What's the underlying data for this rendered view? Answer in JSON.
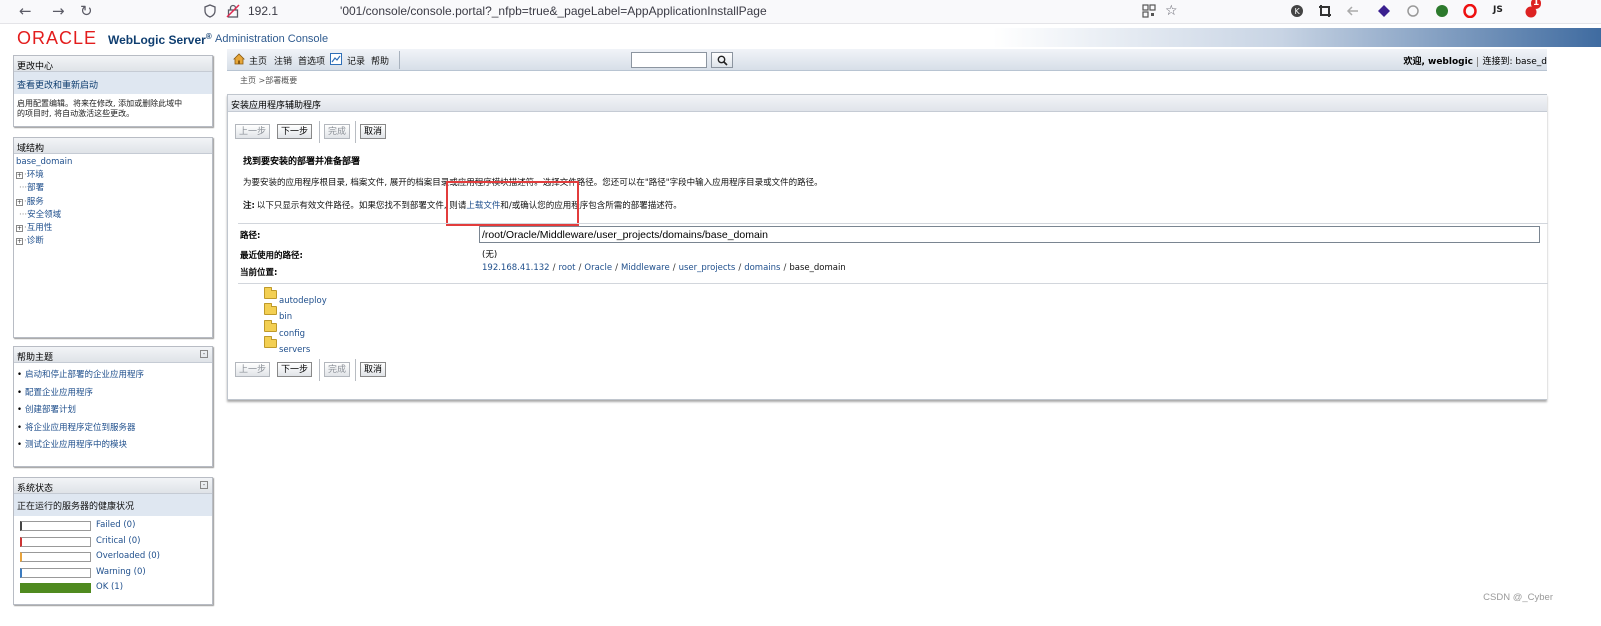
{
  "browser": {
    "url_prefix": "192.1",
    "url_suffix": "'001/console/console.portal?_nfpb=true&_pageLabel=AppApplicationInstallPage",
    "notification_count": "1",
    "extension_js_label": "JS"
  },
  "header": {
    "logo": "ORACLE",
    "product": "WebLogic Server",
    "registered": "®",
    "console": "Administration Console"
  },
  "change_center": {
    "title": "更改中心",
    "link": "查看更改和重新启动",
    "description_line1": "启用配置编辑。将来在修改, 添加或删除此域中",
    "description_line2": "的项目时, 将自动激活这些更改。"
  },
  "domain_structure": {
    "title": "域结构",
    "root": "base_domain",
    "items": [
      {
        "label": "环境",
        "expandable": true
      },
      {
        "label": "部署",
        "expandable": false
      },
      {
        "label": "服务",
        "expandable": true
      },
      {
        "label": "安全领域",
        "expandable": false
      },
      {
        "label": "互用性",
        "expandable": true
      },
      {
        "label": "诊断",
        "expandable": true
      }
    ]
  },
  "help_topics": {
    "title": "帮助主题",
    "items": [
      "启动和停止部署的企业应用程序",
      "配置企业应用程序",
      "创建部署计划",
      "将企业应用程序定位到服务器",
      "测试企业应用程序中的模块"
    ]
  },
  "system_status": {
    "title": "系统状态",
    "subtitle": "正在运行的服务器的健康状况",
    "rows": [
      {
        "label": "Failed (0)",
        "color": "#444444",
        "fill": 0
      },
      {
        "label": "Critical (0)",
        "color": "#cc3333",
        "fill": 0
      },
      {
        "label": "Overloaded (0)",
        "color": "#e8a33c",
        "fill": 0
      },
      {
        "label": "Warning (0)",
        "color": "#3b7bbf",
        "fill": 0
      },
      {
        "label": "OK (1)",
        "color": "#4f8a1f",
        "fill": 1
      }
    ]
  },
  "toolbar": {
    "home": "主页",
    "logout": "注销",
    "preferences": "首选项",
    "record": "记录",
    "help": "帮助",
    "welcome": "欢迎, weblogic",
    "connected": "连接到: base_d"
  },
  "breadcrumb": "主页 >部署概要",
  "wizard": {
    "title": "安装应用程序辅助程序",
    "buttons": {
      "back": "上一步",
      "next": "下一步",
      "finish": "完成",
      "cancel": "取消"
    },
    "heading": "找到要安装的部署并准备部署",
    "instructions": "为要安装的应用程序根目录, 档案文件, 展开的档案目录或应用程序模块描述符。选择文件路径。您还可以在\"路径\"字段中输入应用程序目录或文件的路径。",
    "note_label": "注:",
    "note_before": "以下只显示有效文件路径。如果您找不到部署文件, 则请",
    "note_link": "上载文件",
    "note_after": "和/或确认您的应用程序包含所需的部署描述符。",
    "path_label": "路径:",
    "path_value": "/root/Oracle/Middleware/user_projects/domains/base_domain",
    "recent_label": "最近使用的路径:",
    "recent_value": "(无)",
    "location_label": "当前位置:",
    "location_parts": [
      "192.168.41.132",
      "root",
      "Oracle",
      "Middleware",
      "user_projects",
      "domains"
    ],
    "location_current": "base_domain",
    "folders": [
      "autodeploy",
      "bin",
      "config",
      "servers"
    ]
  },
  "watermark": "CSDN @_Cyber"
}
